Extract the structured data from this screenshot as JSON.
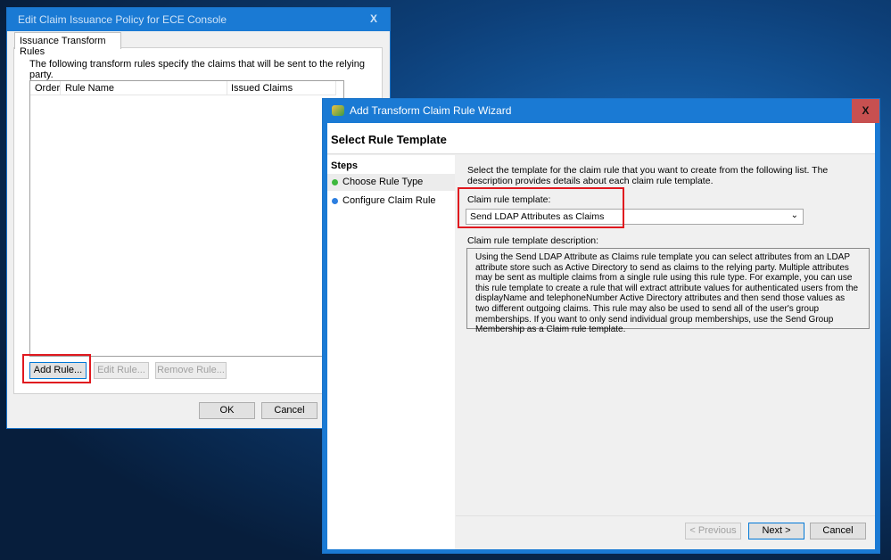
{
  "policy_dialog": {
    "title": "Edit Claim Issuance Policy for ECE Console",
    "close": "X",
    "tab": "Issuance Transform Rules",
    "intro": "The following transform rules specify the claims that will be sent to the relying party.",
    "columns": [
      "Order",
      "Rule Name",
      "Issued Claims"
    ],
    "rows": [],
    "add_rule": "Add Rule...",
    "edit_rule": "Edit Rule...",
    "remove_rule": "Remove Rule...",
    "ok": "OK",
    "cancel": "Cancel"
  },
  "wizard": {
    "title": "Add Transform Claim Rule Wizard",
    "close": "X",
    "heading": "Select Rule Template",
    "steps_label": "Steps",
    "steps": [
      {
        "label": "Choose Rule Type",
        "status_color": "#3db83d",
        "active": true
      },
      {
        "label": "Configure Claim Rule",
        "status_color": "#2d7fe0",
        "active": false
      }
    ],
    "instructions": "Select the template for the claim rule that you want to create from the following list. The description provides details about each claim rule template.",
    "template_label": "Claim rule template:",
    "template_value": "Send LDAP Attributes as Claims",
    "description_label": "Claim rule template description:",
    "description": "Using the Send LDAP Attribute as Claims rule template you can select attributes from an LDAP attribute store such as Active Directory to send as claims to the relying party. Multiple attributes may be sent as multiple claims from a single rule using this rule type. For example, you can use this rule template to create a rule that will extract attribute values for authenticated users from the displayName and telephoneNumber Active Directory attributes and then send those values as two different outgoing claims. This rule may also be used to send all of the user's group memberships. If you want to only send individual group memberships, use the Send Group Membership as a Claim rule template.",
    "previous": "< Previous",
    "next": "Next >",
    "cancel": "Cancel"
  },
  "colors": {
    "titlebar": "#1a7ad4",
    "close_active": "#c75050",
    "highlight": "#e0191f"
  }
}
